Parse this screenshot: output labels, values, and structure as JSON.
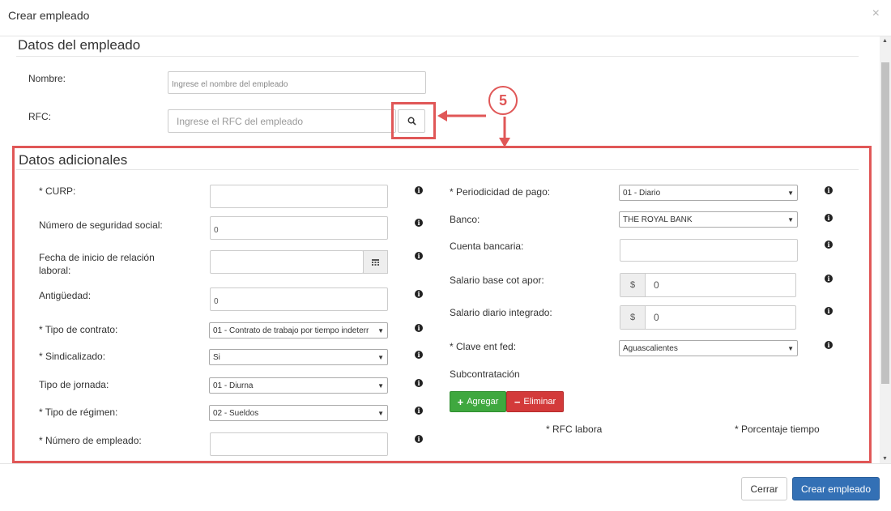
{
  "dialog": {
    "title": "Crear empleado",
    "close_icon": "close-icon"
  },
  "datos_empleado": {
    "title": "Datos del empleado",
    "nombre_label": "Nombre:",
    "nombre_placeholder": "Ingrese el nombre del empleado",
    "rfc_label": "RFC:",
    "rfc_placeholder": "Ingrese el RFC del empleado",
    "search_icon": "search-icon"
  },
  "annotation": {
    "number": "5",
    "color": "#e05757"
  },
  "datos_adicionales": {
    "title": "Datos adicionales",
    "left": {
      "curp_label": "* CURP:",
      "curp_value": "",
      "nss_label": "Número de seguridad social:",
      "nss_value": "0",
      "fecha_label_1": "Fecha de inicio de relación",
      "fecha_label_2": "laboral:",
      "fecha_value": "",
      "calendar_icon": "calendar-icon",
      "antiguedad_label": "Antigüedad:",
      "antiguedad_value": "0",
      "tipo_contrato_label": "* Tipo de contrato:",
      "tipo_contrato_value": "01 - Contrato de trabajo por tiempo indeterr",
      "sindicalizado_label": "* Sindicalizado:",
      "sindicalizado_value": "Si",
      "tipo_jornada_label": "Tipo de jornada:",
      "tipo_jornada_value": "01 - Diurna",
      "tipo_regimen_label": "* Tipo de régimen:",
      "tipo_regimen_value": "02 - Sueldos",
      "numero_empleado_label": "* Número de empleado:",
      "numero_empleado_value": ""
    },
    "right": {
      "periodicidad_label": "* Periodicidad de pago:",
      "periodicidad_value": "01 - Diario",
      "banco_label": "Banco:",
      "banco_value": "THE ROYAL BANK",
      "cuenta_label": "Cuenta bancaria:",
      "cuenta_value": "",
      "salario_base_label": "Salario base cot apor:",
      "salario_base_currency": "$",
      "salario_base_value": "0",
      "salario_diario_label": "Salario diario integrado:",
      "salario_diario_currency": "$",
      "salario_diario_value": "0",
      "clave_ent_label": "* Clave ent fed:",
      "clave_ent_value": "Aguascalientes",
      "subcontratacion_label": "Subcontratación",
      "agregar_label": "Agregar",
      "eliminar_label": "Eliminar",
      "rfc_labora_header": "* RFC labora",
      "porcentaje_header": "* Porcentaje tiempo"
    },
    "info_icon": "info-icon"
  },
  "footer": {
    "cerrar_label": "Cerrar",
    "crear_label": "Crear empleado"
  }
}
